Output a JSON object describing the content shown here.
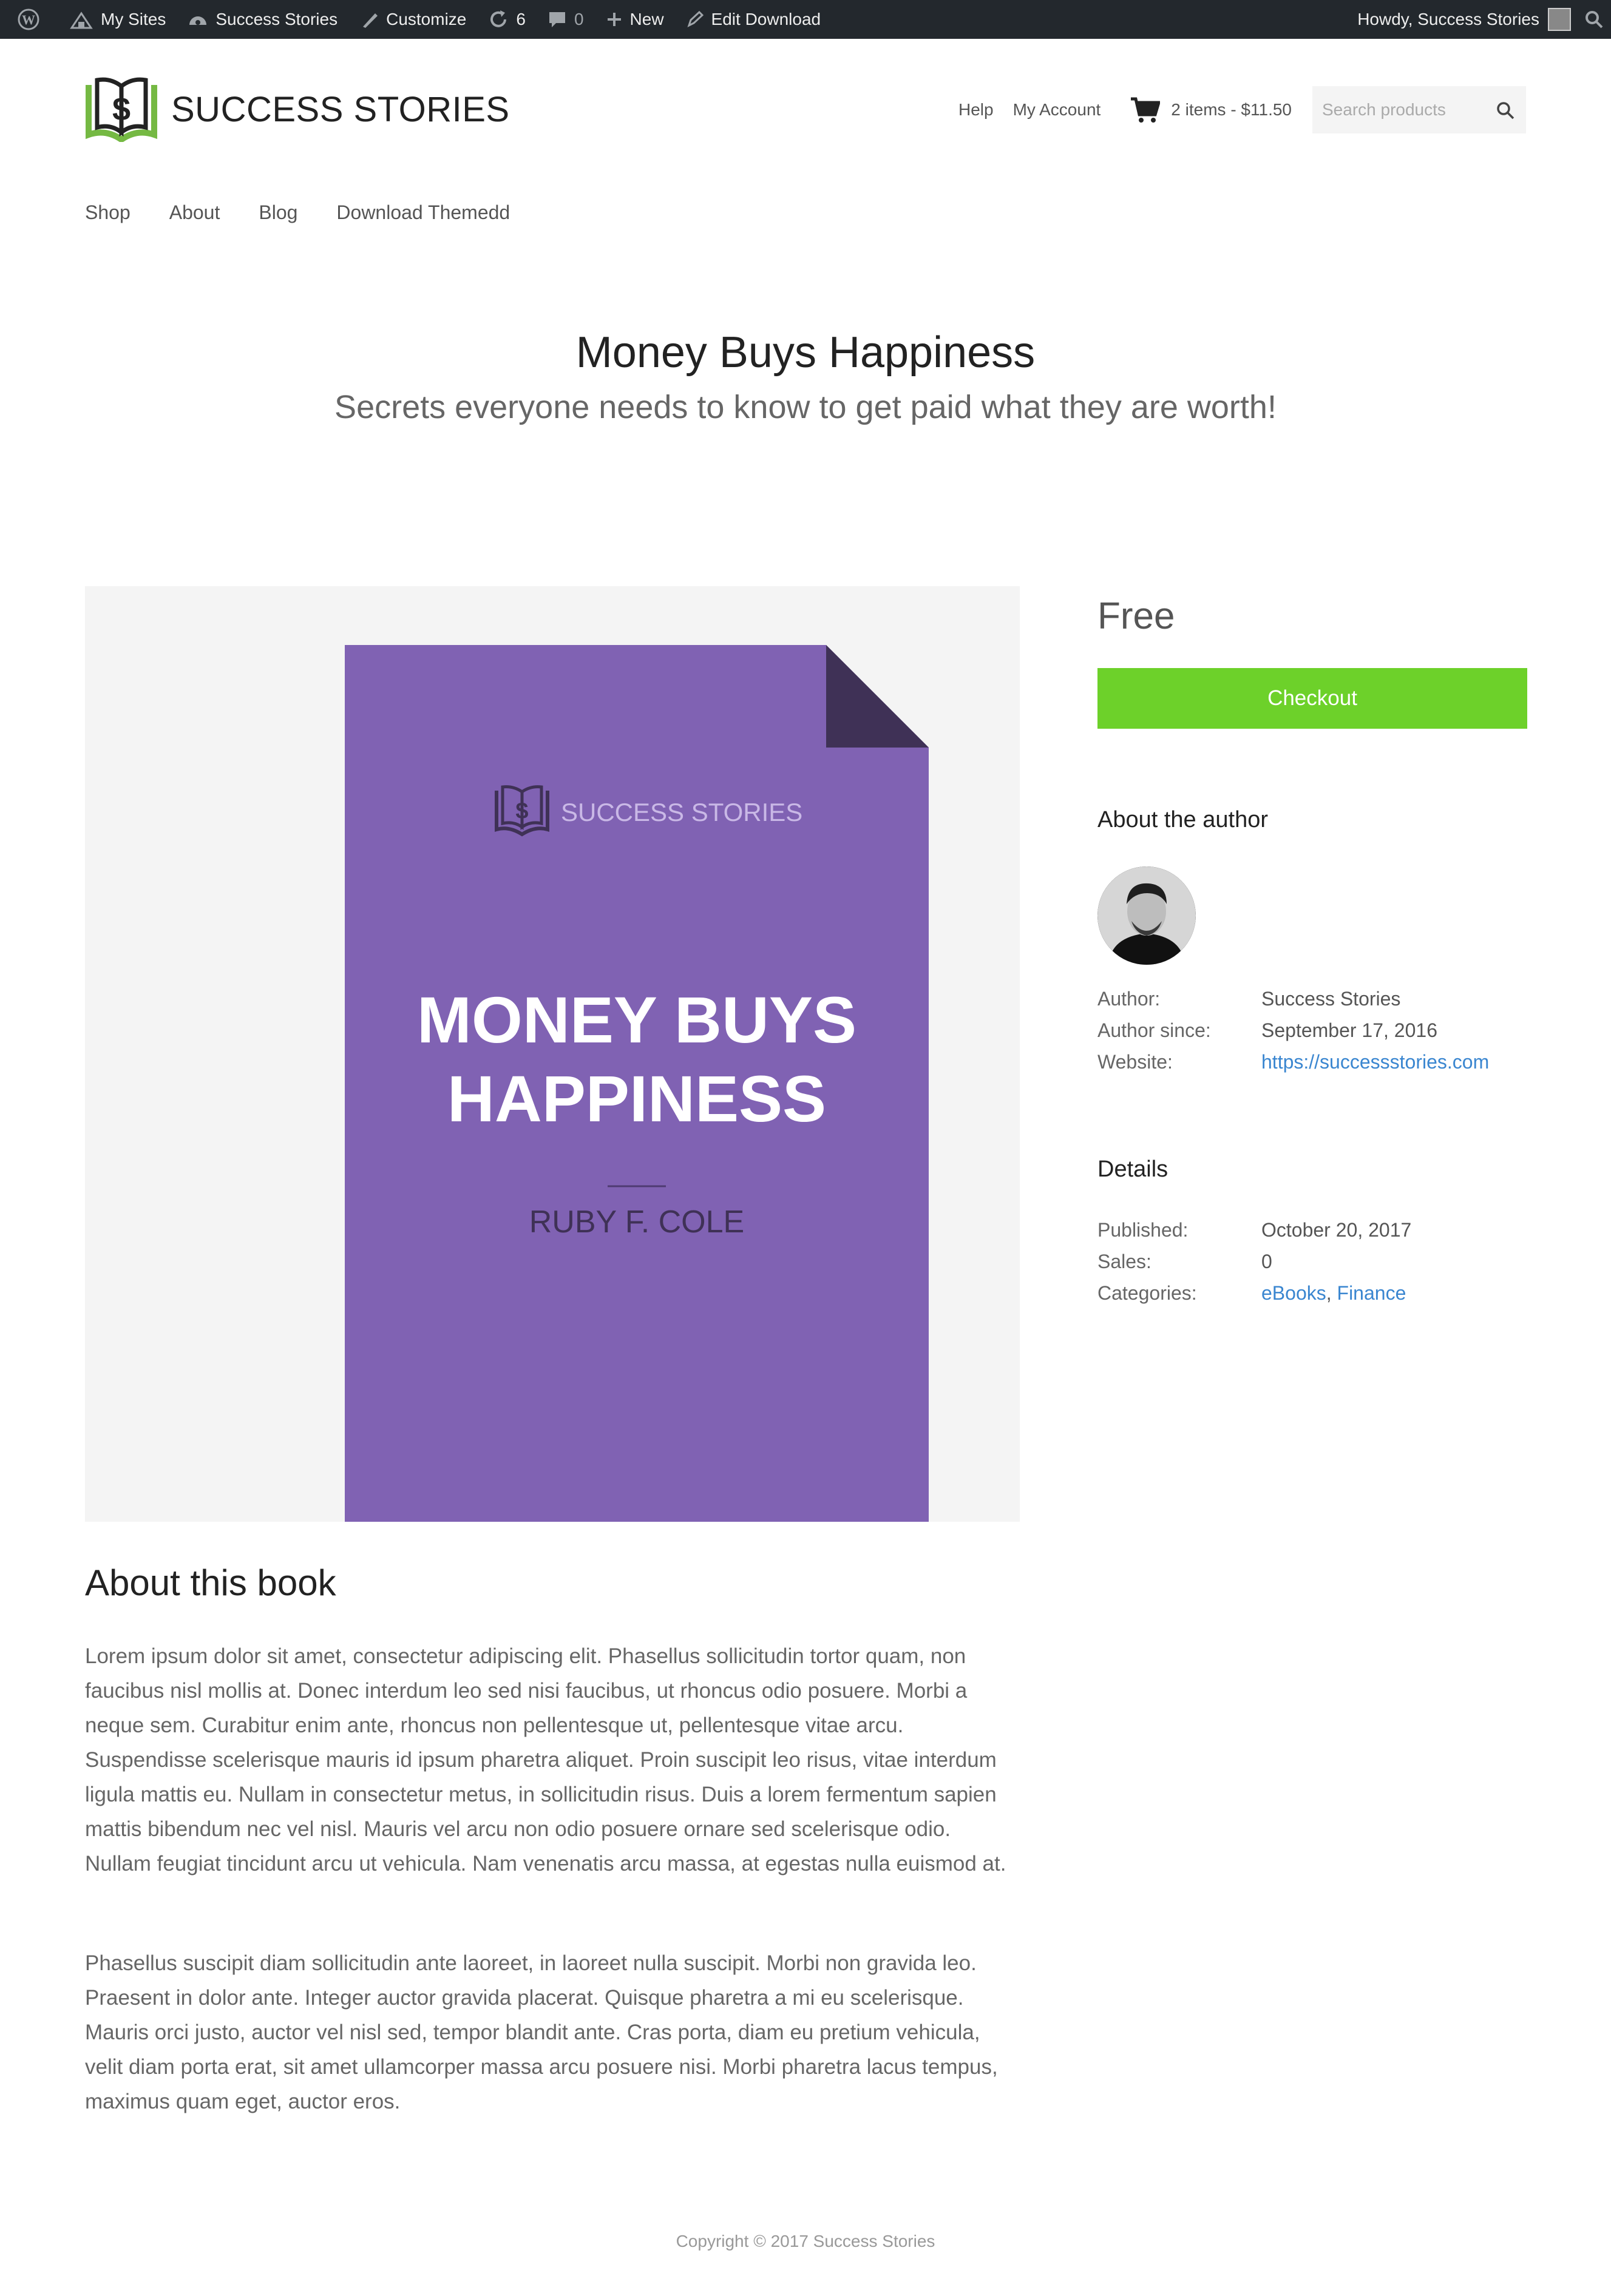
{
  "adminbar": {
    "my_sites": "My Sites",
    "site_name": "Success Stories",
    "customize": "Customize",
    "updates_count": "6",
    "comments_count": "0",
    "new": "New",
    "edit": "Edit Download",
    "howdy": "Howdy, Success Stories"
  },
  "header": {
    "logo_text": "SUCCESS STORIES",
    "help": "Help",
    "my_account": "My Account",
    "cart": "2 items - $11.50",
    "search_placeholder": "Search products"
  },
  "nav": {
    "items": [
      "Shop",
      "About",
      "Blog",
      "Download Themedd"
    ]
  },
  "page": {
    "title": "Money Buys Happiness",
    "subtitle": "Secrets everyone needs to know to get paid what they are worth!"
  },
  "cover": {
    "brand": "SUCCESS STORIES",
    "title_line1": "MONEY BUYS",
    "title_line2": "HAPPINESS",
    "author": "RUBY F. COLE",
    "color": "#8062b3"
  },
  "about_book": {
    "heading": "About this book",
    "paragraphs": [
      "Lorem ipsum dolor sit amet, consectetur adipiscing elit. Phasellus sollicitudin tortor quam, non faucibus nisl mollis at. Donec interdum leo sed nisi faucibus, ut rhoncus odio posuere. Morbi a neque sem. Curabitur enim ante, rhoncus non pellentesque ut, pellentesque vitae arcu. Suspendisse scelerisque mauris id ipsum pharetra aliquet. Proin suscipit leo risus, vitae interdum ligula mattis eu. Nullam in consectetur metus, in sollicitudin risus. Duis a lorem fermentum sapien mattis bibendum nec vel nisl. Mauris vel arcu non odio posuere ornare sed scelerisque odio. Nullam feugiat tincidunt arcu ut vehicula. Nam venenatis arcu massa, at egestas nulla euismod at.",
      "Phasellus suscipit diam sollicitudin ante laoreet, in laoreet nulla suscipit. Morbi non gravida leo. Praesent in dolor ante. Integer auctor gravida placerat. Quisque pharetra a mi eu scelerisque. Mauris orci justo, auctor vel nisl sed, tempor blandit ante. Cras porta, diam eu pretium vehicula, velit diam porta erat, sit amet ullamcorper massa arcu posuere nisi. Morbi pharetra lacus tempus, maximus quam eget, auctor eros."
    ]
  },
  "sidebar": {
    "price": "Free",
    "checkout": "Checkout",
    "checkout_color": "#6dd12a",
    "author_heading": "About the author",
    "author_rows": [
      {
        "label": "Author:",
        "value": "Success Stories"
      },
      {
        "label": "Author since:",
        "value": "September 17, 2016"
      },
      {
        "label": "Website:",
        "value": "https://successstories.com"
      }
    ],
    "details_heading": "Details",
    "details_rows": [
      {
        "label": "Published:",
        "value": "October 20, 2017"
      },
      {
        "label": "Sales:",
        "value": "0"
      },
      {
        "label": "Categories:",
        "value_a": "eBooks",
        "sep": ", ",
        "value_b": "Finance"
      }
    ]
  },
  "footer": {
    "copyright": "Copyright © 2017 Success Stories"
  }
}
